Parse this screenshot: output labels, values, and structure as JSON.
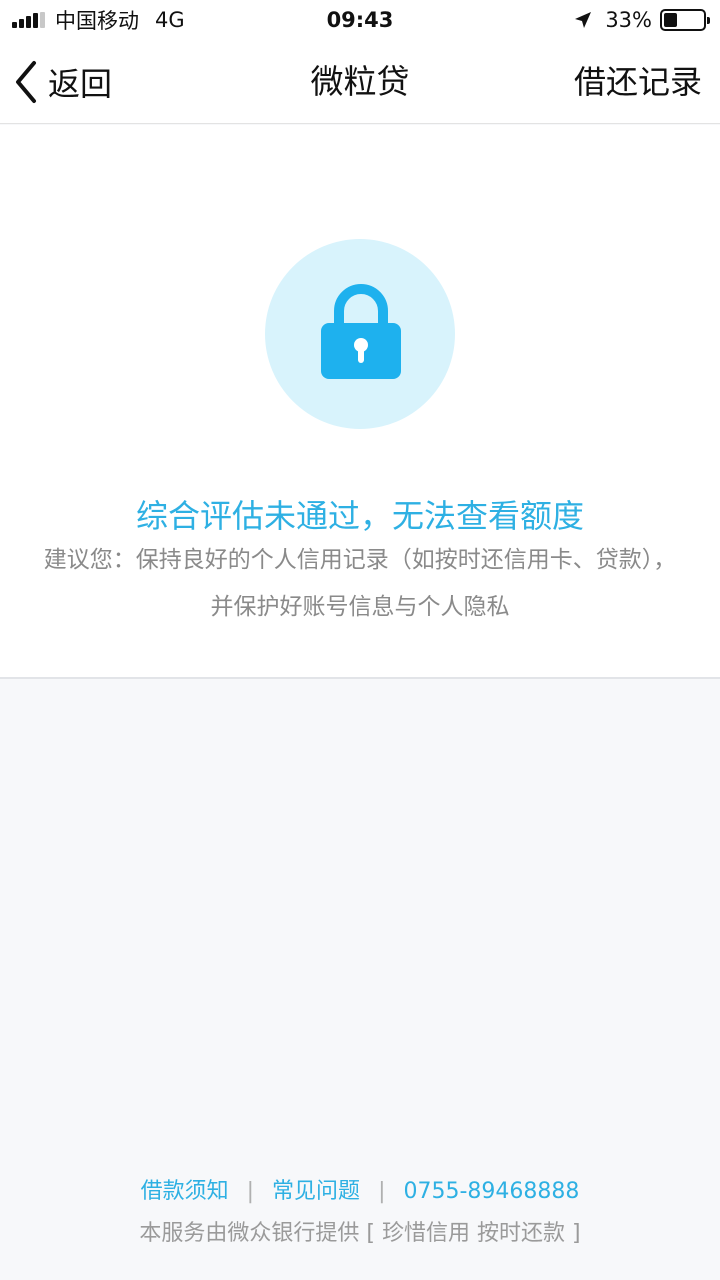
{
  "status_bar": {
    "carrier": "中国移动",
    "network": "4G",
    "time": "09:43",
    "battery_percent": "33%",
    "battery_level": 0.33,
    "icons": [
      "signal-icon",
      "location-arrow-icon",
      "battery-icon"
    ]
  },
  "nav": {
    "back_label": "返回",
    "title": "微粒贷",
    "right_label": "借还记录"
  },
  "result": {
    "title": "综合评估未通过，无法查看额度",
    "advice": "建议您：保持良好的个人信用记录（如按时还信用卡、贷款），并保护好账号信息与个人隐私",
    "icon": "lock-icon"
  },
  "footer": {
    "links": {
      "loan_notice": "借款须知",
      "faq": "常见问题",
      "phone": "0755-89468888"
    },
    "separator": "|",
    "note": "本服务由微众银行提供 [ 珍惜信用 按时还款 ]"
  },
  "colors": {
    "accent": "#2eb0e3",
    "lock": "#1eb1ee",
    "lock_bg": "#d8f3fc",
    "page_bg": "#f7f8fa"
  }
}
